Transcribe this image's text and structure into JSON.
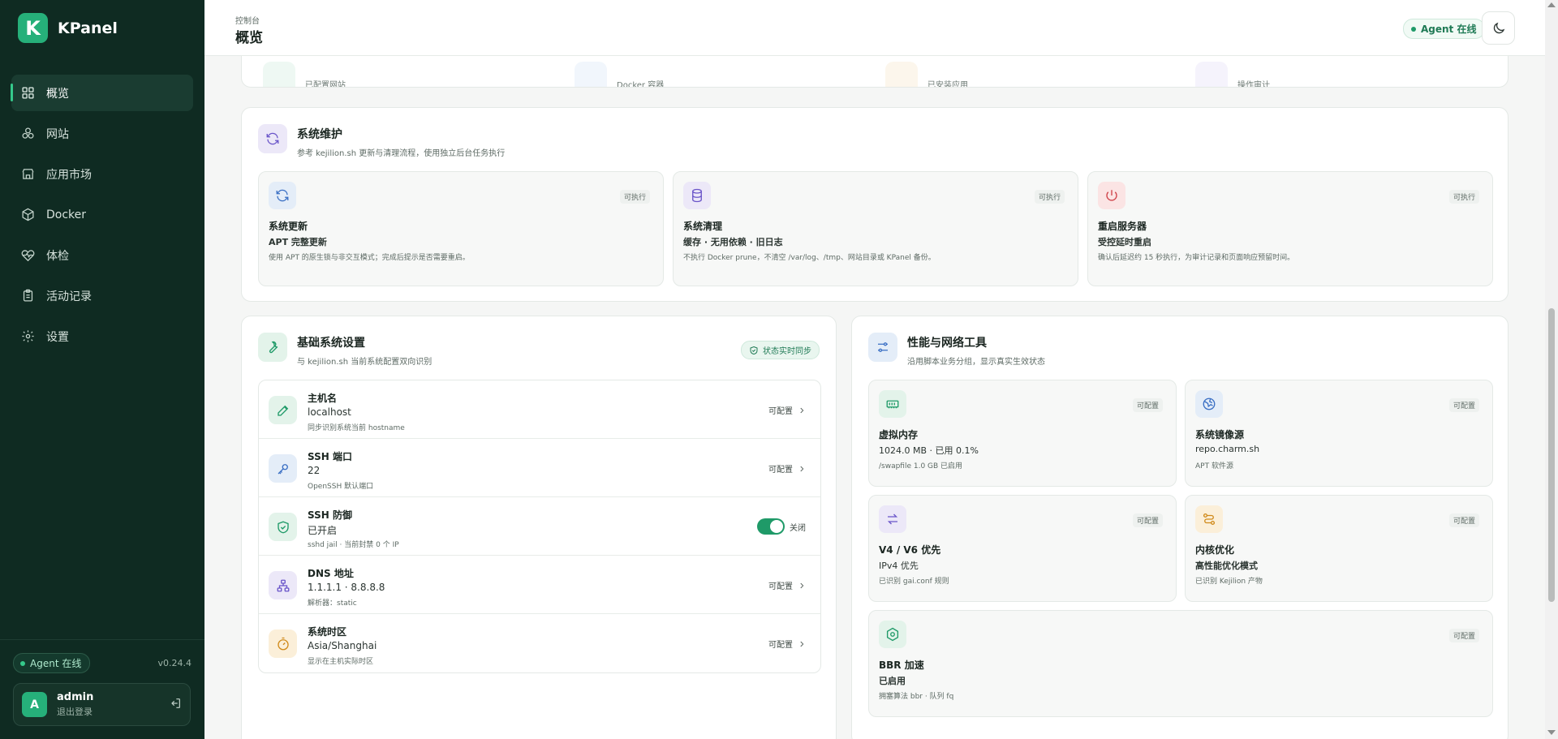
{
  "app": {
    "logo_letter": "K",
    "name": "KPanel"
  },
  "nav": [
    {
      "label": "概览",
      "icon": "grid-icon",
      "active": true
    },
    {
      "label": "网站",
      "icon": "globe-icon"
    },
    {
      "label": "应用市场",
      "icon": "store-icon"
    },
    {
      "label": "Docker",
      "icon": "cube-icon"
    },
    {
      "label": "体检",
      "icon": "heart-pulse-icon"
    },
    {
      "label": "活动记录",
      "icon": "clipboard-icon"
    },
    {
      "label": "设置",
      "icon": "gear-icon"
    }
  ],
  "sidebar_footer": {
    "agent": "Agent 在线",
    "version": "v0.24.4",
    "user_initial": "A",
    "user_name": "admin",
    "user_action": "退出登录"
  },
  "header": {
    "breadcrumb": "控制台",
    "title": "概览",
    "agent": "Agent 在线"
  },
  "top_partial": [
    "已配置网站",
    "Docker 容器",
    "已安装应用",
    "操作审计"
  ],
  "maintenance": {
    "title": "系统维护",
    "subtitle": "参考 kejilion.sh 更新与清理流程，使用独立后台任务执行",
    "tiles": [
      {
        "badge": "可执行",
        "title": "系统更新",
        "value": "APT 完整更新",
        "desc": "使用 APT 的原生锁与非交互模式；完成后提示是否需要重启。"
      },
      {
        "badge": "可执行",
        "title": "系统清理",
        "value": "缓存 · 无用依赖 · 旧日志",
        "desc": "不执行 Docker prune，不清空 /var/log、/tmp、网站目录或 KPanel 备份。"
      },
      {
        "badge": "可执行",
        "title": "重启服务器",
        "value": "受控延时重启",
        "desc": "确认后延迟约 15 秒执行，为审计记录和页面响应预留时间。"
      }
    ]
  },
  "basic": {
    "title": "基础系统设置",
    "subtitle": "与 kejilion.sh 当前系统配置双向识别",
    "sync": "状态实时同步",
    "rows": [
      {
        "label": "主机名",
        "value": "localhost",
        "desc": "同步识别系统当前 hostname",
        "action": "可配置"
      },
      {
        "label": "SSH 端口",
        "value": "22",
        "desc": "OpenSSH 默认端口",
        "action": "可配置"
      },
      {
        "label": "SSH 防御",
        "value": "已开启",
        "desc": "sshd jail · 当前封禁 0 个 IP",
        "action": "关闭"
      },
      {
        "label": "DNS 地址",
        "value": "1.1.1.1 · 8.8.8.8",
        "desc": "解析器：static",
        "action": "可配置"
      },
      {
        "label": "系统时区",
        "value": "Asia/Shanghai",
        "desc": "显示在主机实际时区",
        "action": "可配置"
      }
    ]
  },
  "perf": {
    "title": "性能与网络工具",
    "subtitle": "沿用脚本业务分组，显示真实生效状态",
    "tiles": [
      {
        "badge": "可配置",
        "title": "虚拟内存",
        "value": "1024.0 MB · 已用 0.1%",
        "desc": "/swapfile 1.0 GB 已启用"
      },
      {
        "badge": "可配置",
        "title": "系统镜像源",
        "value": "repo.charm.sh",
        "desc": "APT 软件源"
      },
      {
        "badge": "可配置",
        "title": "V4 / V6 优先",
        "value": "IPv4 优先",
        "desc": "已识别 gai.conf 规则"
      },
      {
        "badge": "可配置",
        "title": "内核优化",
        "value": "高性能优化模式",
        "desc": "已识别 Kejilion 产物"
      },
      {
        "badge": "可配置",
        "title": "BBR 加速",
        "value": "已启用",
        "desc": "拥塞算法 bbr · 队列 fq"
      }
    ]
  },
  "colors": {
    "accent": "#26b07a",
    "sidebar": "#0f2b22"
  }
}
